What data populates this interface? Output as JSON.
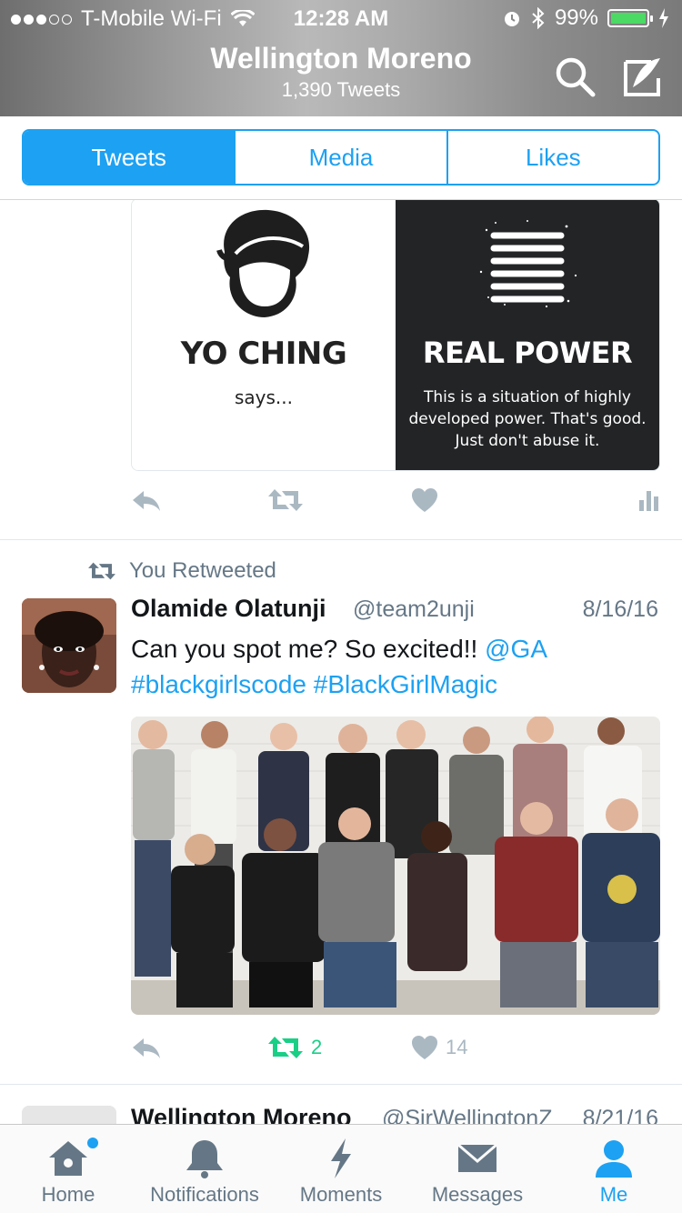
{
  "status_bar": {
    "carrier": "T-Mobile Wi-Fi",
    "time": "12:28 AM",
    "battery": "99%",
    "battery_level": 0.99
  },
  "header": {
    "title": "Wellington Moreno",
    "subtitle": "1,390 Tweets"
  },
  "segments": {
    "tweets": "Tweets",
    "media": "Media",
    "likes": "Likes",
    "selected": "Tweets"
  },
  "tweet1": {
    "card_left": {
      "title": "YO CHING",
      "subtitle": "says..."
    },
    "card_right": {
      "title": "REAL POWER",
      "body": "This is a situation of highly developed power. That's good. Just don't abuse it."
    }
  },
  "tweet2": {
    "retweet_note": "You Retweeted",
    "name": "Olamide Olatunji",
    "handle": "@team2unji",
    "date": "8/16/16",
    "text_plain": "Can you spot me? So excited!! ",
    "mention": "@GA",
    "hashtag1": "#blackgirlscode",
    "hashtag2": "#BlackGirlMagic",
    "retweets": "2",
    "likes": "14"
  },
  "tweet3": {
    "name": "Wellington Moreno",
    "handle": "@SirWellingtonZ",
    "date": "8/21/16"
  },
  "tab_bar": {
    "home": "Home",
    "notifications": "Notifications",
    "moments": "Moments",
    "messages": "Messages",
    "me": "Me",
    "active": "Me"
  },
  "colors": {
    "accent": "#1da1f2",
    "retweet_active": "#19cf86",
    "icon_gray": "#aab8c2",
    "text_secondary": "#657786"
  }
}
